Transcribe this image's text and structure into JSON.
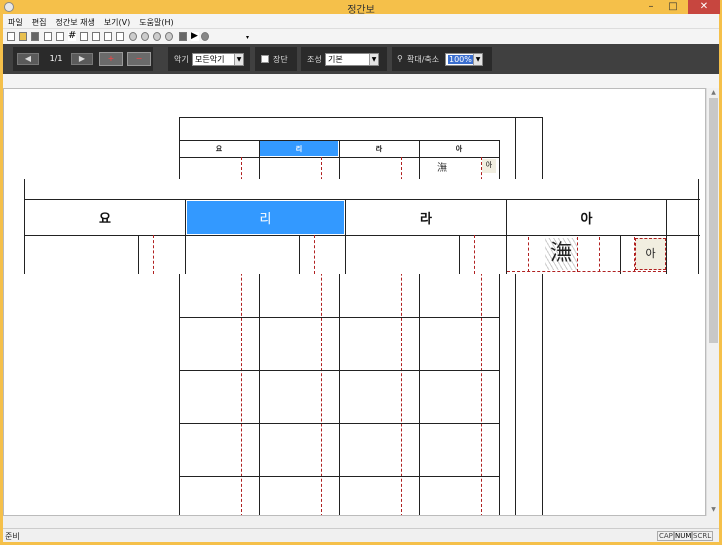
{
  "window": {
    "title": "정간보"
  },
  "menu": [
    "파일",
    "편집",
    "정간보 재생",
    "보기(V)",
    "도움말(H)"
  ],
  "icons": [
    "new-icon",
    "open-icon",
    "save-icon",
    "print-icon",
    "print-preview-icon",
    "grid-icon",
    "cut-icon",
    "copy-icon",
    "paste-icon",
    "undo-icon",
    "record-icon",
    "rewind-icon",
    "stop-icon",
    "play-icon",
    "help-icon"
  ],
  "toolbar": {
    "page_indicator": "1/1",
    "add_page_symbol": "+",
    "remove_page_symbol": "−",
    "instrument_label": "악기",
    "instrument_value": "모든악기",
    "jangdan_label": "장단",
    "scale_label": "조성",
    "scale_value": "기본",
    "zoom_label": "확대/축소",
    "zoom_value": "100%"
  },
  "sheet": {
    "header_cells": [
      "요",
      "리",
      "라",
      "아"
    ],
    "selected_index": 1,
    "note_char": "潕",
    "small_note": "아"
  },
  "status": {
    "text": "준비",
    "indicators": [
      "CAP",
      "NUM",
      "SCRL"
    ]
  },
  "colors": {
    "title_bar": "#f5c04a",
    "control_bar": "#404040",
    "selected_cell": "#3399ff",
    "dashed_line": "#b02020"
  }
}
